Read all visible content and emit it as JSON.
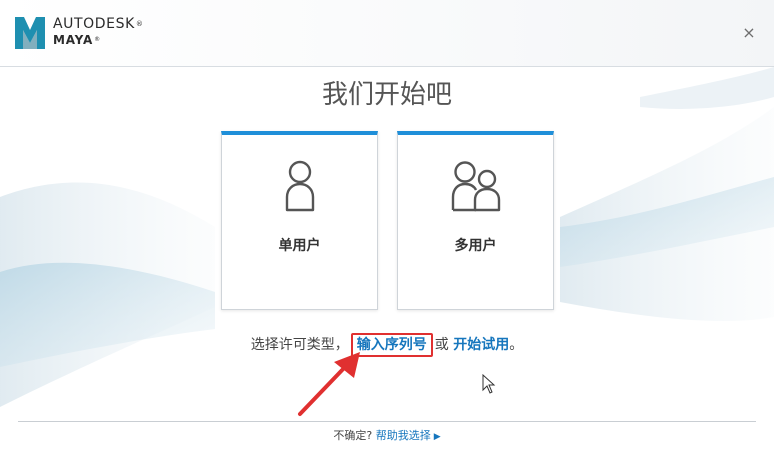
{
  "header": {
    "brand_top": "AUTODESK",
    "brand_bottom": "MAYA",
    "registered_mark": "®",
    "logo_letter": "M",
    "close_label": "×"
  },
  "main": {
    "title": "我们开始吧",
    "cards": [
      {
        "label": "单用户",
        "icon": "single-user-icon"
      },
      {
        "label": "多用户",
        "icon": "multi-user-icon"
      }
    ],
    "choice": {
      "prefix": "选择许可类型，",
      "serial_link": "输入序列号",
      "or": "或",
      "trial_link": "开始试用",
      "suffix": "。"
    }
  },
  "footer": {
    "unsure": "不确定?",
    "help_link": "帮助我选择",
    "arrow": "▶"
  },
  "colors": {
    "accent": "#1f8fd9",
    "link": "#1676bd",
    "annotation": "#e03030"
  }
}
